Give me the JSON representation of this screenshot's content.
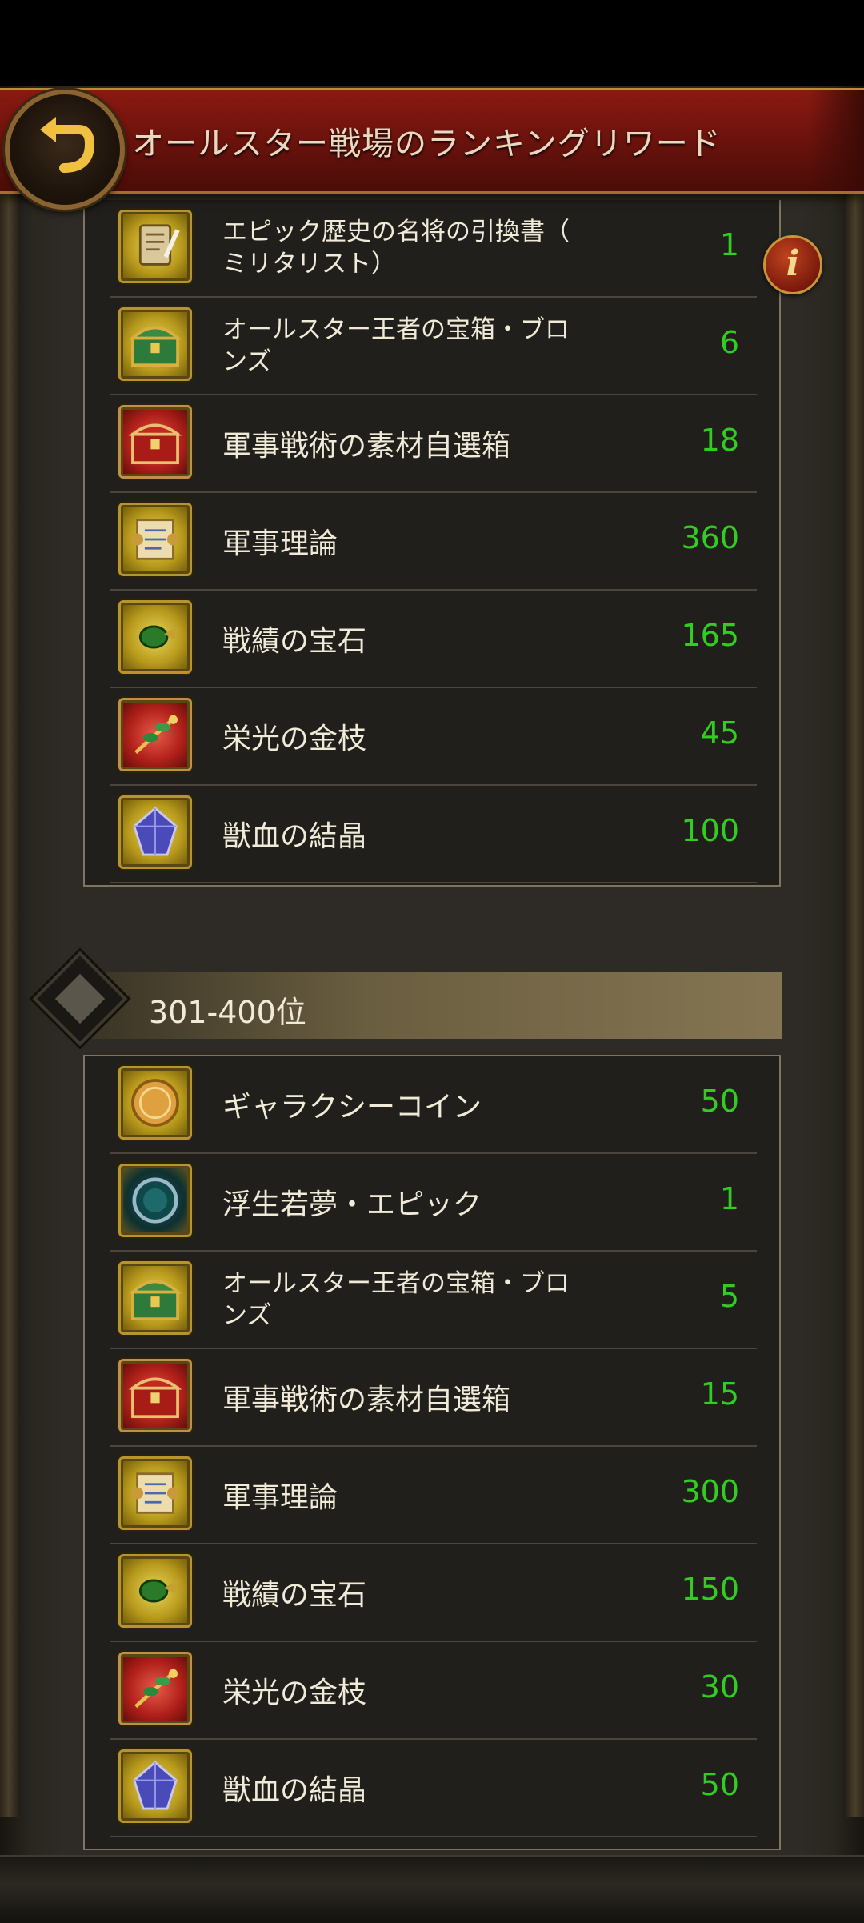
{
  "header": {
    "title": "オールスター戦場のランキングリワード"
  },
  "top_list": [
    {
      "name": "エピック歴史の名将の引換書（ミリタリスト）",
      "line1": "エピック歴史の名将の引換書（",
      "line2": "ミリタリスト）",
      "count": "1",
      "icon": "scroll-feather-icon",
      "frame": "gold"
    },
    {
      "name": "オールスター王者の宝箱・ブロンズ",
      "line1": "オールスター王者の宝箱・ブロ",
      "line2": "ンズ",
      "count": "6",
      "icon": "treasure-chest-icon",
      "frame": "gold"
    },
    {
      "name": "軍事戦術の素材自選箱",
      "count": "18",
      "icon": "red-chest-icon",
      "frame": "red"
    },
    {
      "name": "軍事理論",
      "count": "360",
      "icon": "scroll-icon",
      "frame": "gold"
    },
    {
      "name": "戦績の宝石",
      "count": "165",
      "icon": "green-gem-icon",
      "frame": "gold"
    },
    {
      "name": "栄光の金枝",
      "count": "45",
      "icon": "golden-branch-icon",
      "frame": "red"
    },
    {
      "name": "獣血の結晶",
      "count": "100",
      "icon": "crystal-icon",
      "frame": "gold"
    }
  ],
  "rank_section": {
    "label": "301-400位"
  },
  "bottom_list": [
    {
      "name": "ギャラクシーコイン",
      "count": "50",
      "icon": "coin-icon",
      "frame": "gold"
    },
    {
      "name": "浮生若夢・エピック",
      "count": "1",
      "icon": "frame-ring-icon",
      "frame": "gold"
    },
    {
      "name": "オールスター王者の宝箱・ブロンズ",
      "line1": "オールスター王者の宝箱・ブロ",
      "line2": "ンズ",
      "count": "5",
      "icon": "treasure-chest-icon",
      "frame": "gold"
    },
    {
      "name": "軍事戦術の素材自選箱",
      "count": "15",
      "icon": "red-chest-icon",
      "frame": "red"
    },
    {
      "name": "軍事理論",
      "count": "300",
      "icon": "scroll-icon",
      "frame": "gold"
    },
    {
      "name": "戦績の宝石",
      "count": "150",
      "icon": "green-gem-icon",
      "frame": "gold"
    },
    {
      "name": "栄光の金枝",
      "count": "30",
      "icon": "golden-branch-icon",
      "frame": "red"
    },
    {
      "name": "獣血の結晶",
      "count": "50",
      "icon": "crystal-icon",
      "frame": "gold"
    }
  ],
  "colors": {
    "count_green": "#33cc22",
    "header_red": "#7a160e",
    "gold_frame": "#b8942c"
  }
}
